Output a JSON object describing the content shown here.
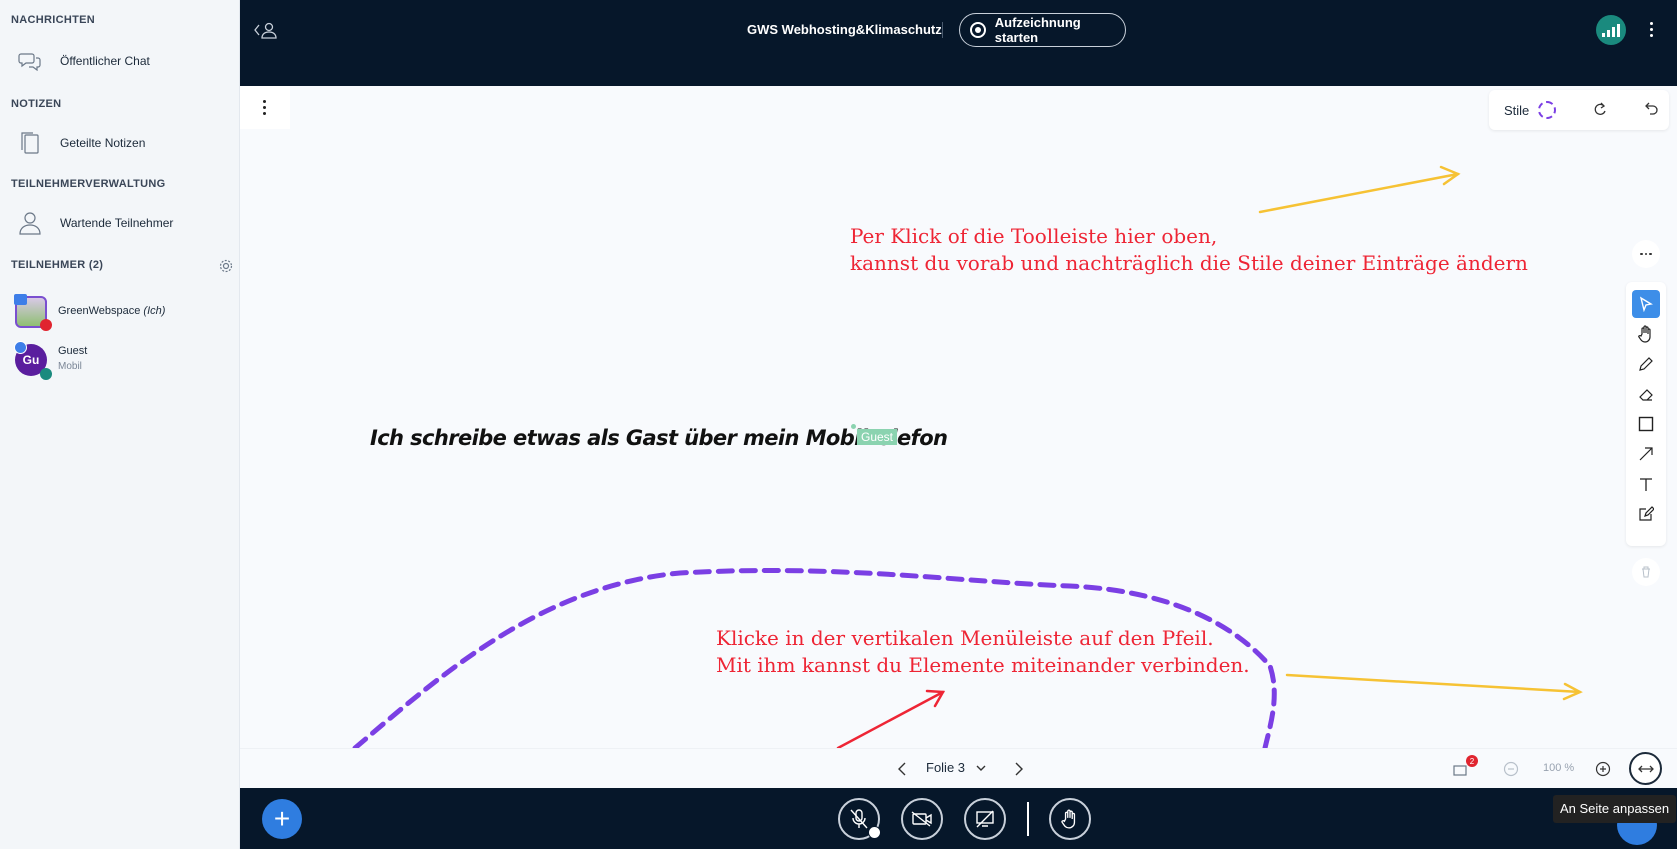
{
  "sidebar": {
    "messages_heading": "NACHRICHTEN",
    "public_chat": "Öffentlicher Chat",
    "notes_heading": "NOTIZEN",
    "shared_notes": "Geteilte Notizen",
    "management_heading": "TEILNEHMERVERWALTUNG",
    "waiting_users": "Wartende Teilnehmer",
    "participants_heading": "TEILNEHMER (2)",
    "users": [
      {
        "name": "GreenWebspace",
        "suffix": "(Ich)",
        "sub": ""
      },
      {
        "name": "Guest",
        "suffix": "",
        "sub": "Mobil",
        "initials": "Gu"
      }
    ]
  },
  "header": {
    "title": "GWS Webhosting&Klimaschutz",
    "record_label": "Aufzeichnung starten"
  },
  "whiteboard": {
    "style_label": "Stile",
    "annotation_top": [
      "Per Klick of die Toolleiste hier oben,",
      "kannst du vorab und nachträglich die Stile deiner Einträge ändern"
    ],
    "annotation_bottom": [
      "Klicke in der vertikalen Menüleiste auf den Pfeil.",
      "Mit ihm kannst du Elemente miteinander verbinden."
    ],
    "guest_text": "Ich schreibe etwas als Gast über mein Mobiltelefon",
    "cursor_label": "Guest",
    "colors": {
      "annotation": "#ee2535",
      "arrow_yellow": "#f6c234",
      "dashed": "#7b3fe4"
    }
  },
  "slide_controls": {
    "slide_label": "Folie 3",
    "zoom": "100 %",
    "notification_count": "2"
  },
  "tooltip": "An Seite anpassen"
}
